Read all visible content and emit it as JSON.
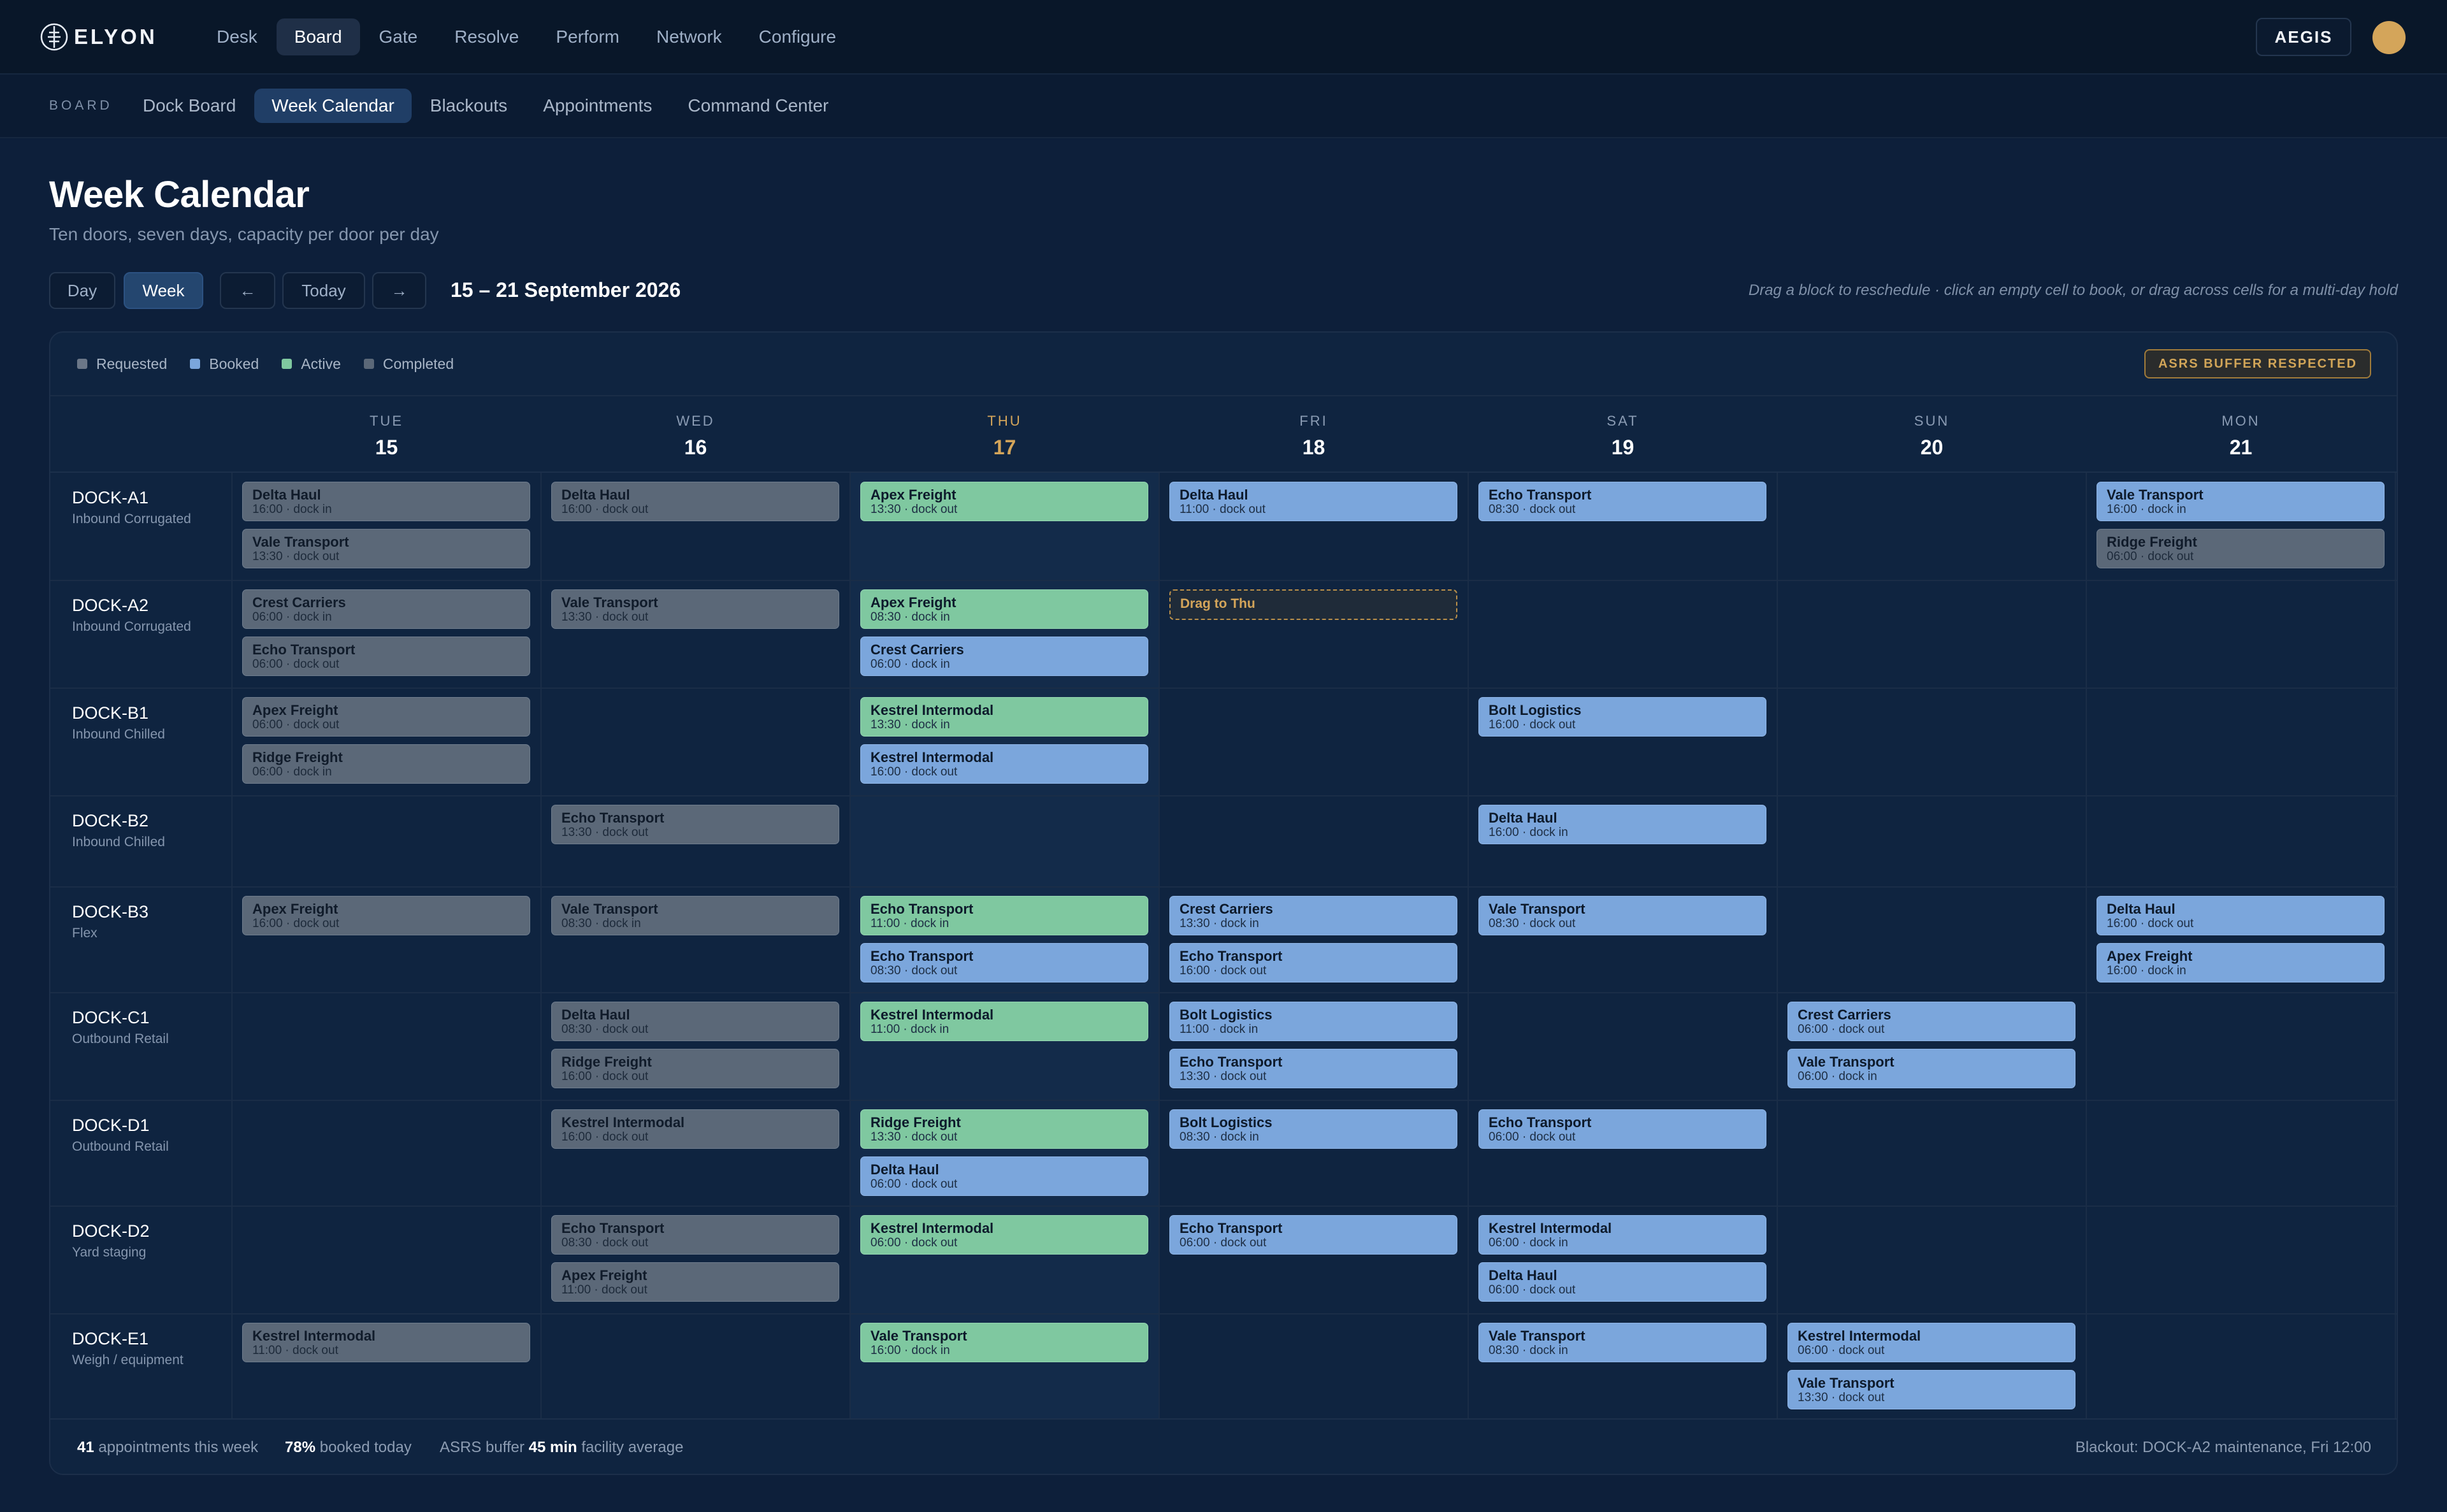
{
  "app": {
    "brand": "ELYON",
    "nav": [
      "Desk",
      "Board",
      "Gate",
      "Resolve",
      "Perform",
      "Network",
      "Configure"
    ],
    "nav_active": "Board",
    "tenant": "AEGIS"
  },
  "subnav": {
    "section": "BOARD",
    "items": [
      "Dock Board",
      "Week Calendar",
      "Blackouts",
      "Appointments",
      "Command Center"
    ],
    "active": "Week Calendar"
  },
  "page": {
    "title": "Week Calendar",
    "subtitle": "Ten doors, seven days, capacity per door per day"
  },
  "toolbar": {
    "view_day": "Day",
    "view_week": "Week",
    "prev": "←",
    "today": "Today",
    "next": "→",
    "range": "15 – 21 September 2026",
    "hint": "Drag a block to reschedule · click an empty cell to book, or drag across cells for a multi-day hold"
  },
  "legend": [
    {
      "label": "Requested",
      "color": "#6b7788"
    },
    {
      "label": "Booked",
      "color": "#7ba6dc"
    },
    {
      "label": "Active",
      "color": "#7fc8a0"
    },
    {
      "label": "Completed",
      "color": "#5b6878"
    }
  ],
  "badge": "ASRS BUFFER RESPECTED",
  "days": [
    {
      "name": "TUE",
      "num": "15",
      "today": false
    },
    {
      "name": "WED",
      "num": "16",
      "today": false
    },
    {
      "name": "THU",
      "num": "17",
      "today": true
    },
    {
      "name": "FRI",
      "num": "18",
      "today": false
    },
    {
      "name": "SAT",
      "num": "19",
      "today": false
    },
    {
      "name": "SUN",
      "num": "20",
      "today": false
    },
    {
      "name": "MON",
      "num": "21",
      "today": false
    }
  ],
  "docks": [
    {
      "name": "DOCK-A1",
      "type": "Inbound Corrugated",
      "cells": [
        [
          {
            "carrier": "Delta Haul",
            "time": "16:00 · dock in",
            "status": "requested"
          },
          {
            "carrier": "Vale Transport",
            "time": "13:30 · dock out",
            "status": "requested"
          }
        ],
        [
          {
            "carrier": "Delta Haul",
            "time": "16:00 · dock out",
            "status": "requested"
          }
        ],
        [
          {
            "carrier": "Apex Freight",
            "time": "13:30 · dock out",
            "status": "active"
          }
        ],
        [
          {
            "carrier": "Delta Haul",
            "time": "11:00 · dock out",
            "status": "booked"
          }
        ],
        [
          {
            "carrier": "Echo Transport",
            "time": "08:30 · dock out",
            "status": "booked"
          }
        ],
        [],
        [
          {
            "carrier": "Vale Transport",
            "time": "16:00 · dock in",
            "status": "booked"
          },
          {
            "carrier": "Ridge Freight",
            "time": "06:00 · dock out",
            "status": "requested"
          }
        ]
      ]
    },
    {
      "name": "DOCK-A2",
      "type": "Inbound Corrugated",
      "cells": [
        [
          {
            "carrier": "Crest Carriers",
            "time": "06:00 · dock in",
            "status": "requested"
          },
          {
            "carrier": "Echo Transport",
            "time": "06:00 · dock out",
            "status": "requested"
          }
        ],
        [
          {
            "carrier": "Vale Transport",
            "time": "13:30 · dock out",
            "status": "requested"
          }
        ],
        [
          {
            "carrier": "Apex Freight",
            "time": "08:30 · dock in",
            "status": "active"
          },
          {
            "carrier": "Crest Carriers",
            "time": "06:00 · dock in",
            "status": "booked"
          }
        ],
        [
          {
            "carrier": "Drag to Thu",
            "time": "",
            "status": "drop"
          }
        ],
        [],
        [],
        []
      ]
    },
    {
      "name": "DOCK-B1",
      "type": "Inbound Chilled",
      "cells": [
        [
          {
            "carrier": "Apex Freight",
            "time": "06:00 · dock out",
            "status": "requested"
          },
          {
            "carrier": "Ridge Freight",
            "time": "06:00 · dock in",
            "status": "requested"
          }
        ],
        [],
        [
          {
            "carrier": "Kestrel Intermodal",
            "time": "13:30 · dock in",
            "status": "active"
          },
          {
            "carrier": "Kestrel Intermodal",
            "time": "16:00 · dock out",
            "status": "booked"
          }
        ],
        [],
        [
          {
            "carrier": "Bolt Logistics",
            "time": "16:00 · dock out",
            "status": "booked"
          }
        ],
        [],
        []
      ]
    },
    {
      "name": "DOCK-B2",
      "type": "Inbound Chilled",
      "cells": [
        [],
        [
          {
            "carrier": "Echo Transport",
            "time": "13:30 · dock out",
            "status": "requested"
          }
        ],
        [],
        [],
        [
          {
            "carrier": "Delta Haul",
            "time": "16:00 · dock in",
            "status": "booked"
          }
        ],
        [],
        []
      ]
    },
    {
      "name": "DOCK-B3",
      "type": "Flex",
      "cells": [
        [
          {
            "carrier": "Apex Freight",
            "time": "16:00 · dock out",
            "status": "requested"
          }
        ],
        [
          {
            "carrier": "Vale Transport",
            "time": "08:30 · dock in",
            "status": "requested"
          }
        ],
        [
          {
            "carrier": "Echo Transport",
            "time": "11:00 · dock in",
            "status": "active"
          },
          {
            "carrier": "Echo Transport",
            "time": "08:30 · dock out",
            "status": "booked"
          }
        ],
        [
          {
            "carrier": "Crest Carriers",
            "time": "13:30 · dock in",
            "status": "booked"
          },
          {
            "carrier": "Echo Transport",
            "time": "16:00 · dock out",
            "status": "booked"
          }
        ],
        [
          {
            "carrier": "Vale Transport",
            "time": "08:30 · dock out",
            "status": "booked"
          }
        ],
        [],
        [
          {
            "carrier": "Delta Haul",
            "time": "16:00 · dock out",
            "status": "booked"
          },
          {
            "carrier": "Apex Freight",
            "time": "16:00 · dock in",
            "status": "booked"
          }
        ]
      ]
    },
    {
      "name": "DOCK-C1",
      "type": "Outbound Retail",
      "cells": [
        [],
        [
          {
            "carrier": "Delta Haul",
            "time": "08:30 · dock out",
            "status": "requested"
          },
          {
            "carrier": "Ridge Freight",
            "time": "16:00 · dock out",
            "status": "requested"
          }
        ],
        [
          {
            "carrier": "Kestrel Intermodal",
            "time": "11:00 · dock in",
            "status": "active"
          }
        ],
        [
          {
            "carrier": "Bolt Logistics",
            "time": "11:00 · dock in",
            "status": "booked"
          },
          {
            "carrier": "Echo Transport",
            "time": "13:30 · dock out",
            "status": "booked"
          }
        ],
        [],
        [
          {
            "carrier": "Crest Carriers",
            "time": "06:00 · dock out",
            "status": "booked"
          },
          {
            "carrier": "Vale Transport",
            "time": "06:00 · dock in",
            "status": "booked"
          }
        ],
        []
      ]
    },
    {
      "name": "DOCK-D1",
      "type": "Outbound Retail",
      "cells": [
        [],
        [
          {
            "carrier": "Kestrel Intermodal",
            "time": "16:00 · dock out",
            "status": "requested"
          }
        ],
        [
          {
            "carrier": "Ridge Freight",
            "time": "13:30 · dock out",
            "status": "active"
          },
          {
            "carrier": "Delta Haul",
            "time": "06:00 · dock out",
            "status": "booked"
          }
        ],
        [
          {
            "carrier": "Bolt Logistics",
            "time": "08:30 · dock in",
            "status": "booked"
          }
        ],
        [
          {
            "carrier": "Echo Transport",
            "time": "06:00 · dock out",
            "status": "booked"
          }
        ],
        [],
        []
      ]
    },
    {
      "name": "DOCK-D2",
      "type": "Yard staging",
      "cells": [
        [],
        [
          {
            "carrier": "Echo Transport",
            "time": "08:30 · dock out",
            "status": "requested"
          },
          {
            "carrier": "Apex Freight",
            "time": "11:00 · dock out",
            "status": "requested"
          }
        ],
        [
          {
            "carrier": "Kestrel Intermodal",
            "time": "06:00 · dock out",
            "status": "active"
          }
        ],
        [
          {
            "carrier": "Echo Transport",
            "time": "06:00 · dock out",
            "status": "booked"
          }
        ],
        [
          {
            "carrier": "Kestrel Intermodal",
            "time": "06:00 · dock in",
            "status": "booked"
          },
          {
            "carrier": "Delta Haul",
            "time": "06:00 · dock out",
            "status": "booked"
          }
        ],
        [],
        []
      ]
    },
    {
      "name": "DOCK-E1",
      "type": "Weigh / equipment",
      "cells": [
        [
          {
            "carrier": "Kestrel Intermodal",
            "time": "11:00 · dock out",
            "status": "requested"
          }
        ],
        [],
        [
          {
            "carrier": "Vale Transport",
            "time": "16:00 · dock in",
            "status": "active"
          }
        ],
        [],
        [
          {
            "carrier": "Vale Transport",
            "time": "08:30 · dock in",
            "status": "booked"
          }
        ],
        [
          {
            "carrier": "Kestrel Intermodal",
            "time": "06:00 · dock out",
            "status": "booked"
          },
          {
            "carrier": "Vale Transport",
            "time": "13:30 · dock out",
            "status": "booked"
          }
        ],
        []
      ]
    }
  ],
  "footer": {
    "appointments_value": "41",
    "appointments_label": "appointments this week",
    "booked_value": "78%",
    "booked_label": "booked today",
    "buffer_prefix": "ASRS buffer",
    "buffer_value": "45 min",
    "buffer_suffix": "facility average",
    "blackout": "Blackout: DOCK-A2 maintenance, Fri 12:00"
  }
}
